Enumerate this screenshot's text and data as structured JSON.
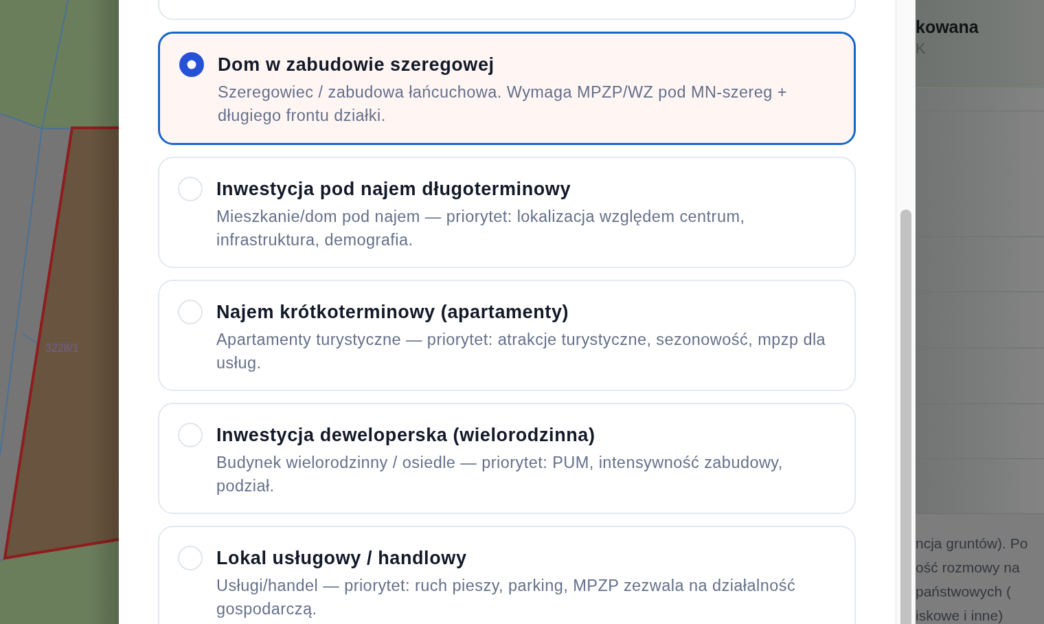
{
  "map": {
    "parcel_label": "3228/1"
  },
  "options": [
    {
      "title": "Dom w zabudowie szeregowej",
      "description": "Szeregowiec / zabudowa łańcuchowa. Wymaga MPZP/WZ pod MN-szereg + długiego frontu działki.",
      "selected": true
    },
    {
      "title": "Inwestycja pod najem długoterminowy",
      "description": "Mieszkanie/dom pod najem — priorytet: lokalizacja względem centrum, infrastruktura, demografia.",
      "selected": false
    },
    {
      "title": "Najem krótkoterminowy (apartamenty)",
      "description": "Apartamenty turystyczne — priorytet: atrakcje turystyczne, sezonowość, mpzp dla usług.",
      "selected": false
    },
    {
      "title": "Inwestycja deweloperska (wielorodzinna)",
      "description": "Budynek wielorodzinny / osiedle — priorytet: PUM, intensywność zabudowy, podział.",
      "selected": false
    },
    {
      "title": "Lokal usługowy / handlowy",
      "description": "Usługi/handel — priorytet: ruch pieszy, parking, MPZP zezwala na działalność gospodarczą.",
      "selected": false
    }
  ],
  "background_panel": {
    "title": "kowana",
    "subtitle": "K",
    "text_lines": [
      "ncja gruntów). Po",
      "ość rozmowy na",
      "państwowych (",
      "iskowe i inne)"
    ]
  }
}
